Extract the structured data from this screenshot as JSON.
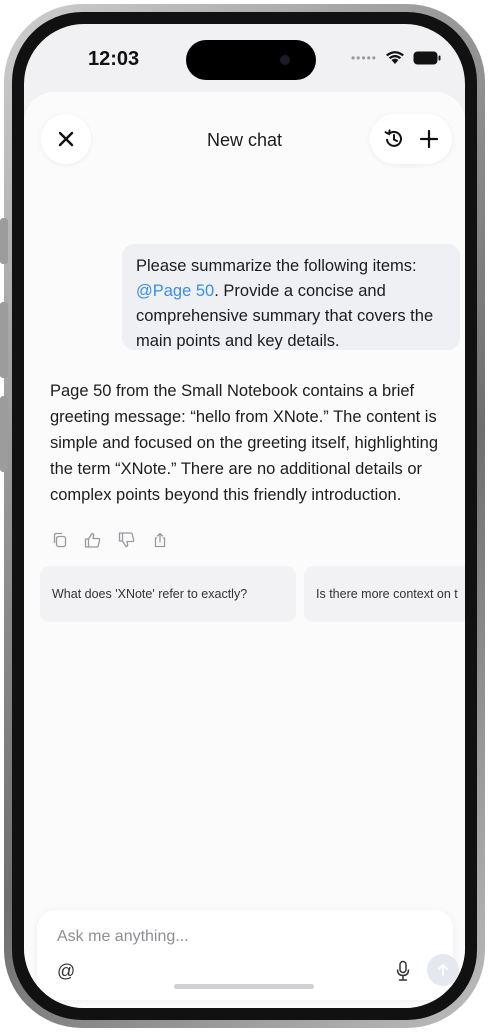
{
  "status_bar": {
    "time": "12:03"
  },
  "header": {
    "title": "New chat"
  },
  "user_message": {
    "before_mention": "Please summarize the following items: ",
    "mention": "@Page 50",
    "after_mention": ". Provide a concise and comprehensive summary that covers the main points and key details."
  },
  "assistant_message": {
    "text": "Page 50 from the Small Notebook contains a brief greeting message: “hello from XNote.” The content is simple and focused on the greeting itself, highlighting the term “XNote.” There are no additional details or complex points beyond this friendly introduction."
  },
  "message_actions": [
    "copy-icon",
    "thumbs-up-icon",
    "thumbs-down-icon",
    "share-icon"
  ],
  "suggestions": [
    "What does 'XNote' refer to exactly?",
    "Is there more context on t"
  ],
  "composer": {
    "placeholder": "Ask me anything...",
    "mention_symbol": "@"
  },
  "colors": {
    "mention": "#3a8ee6",
    "background": "#fbfbfc"
  }
}
